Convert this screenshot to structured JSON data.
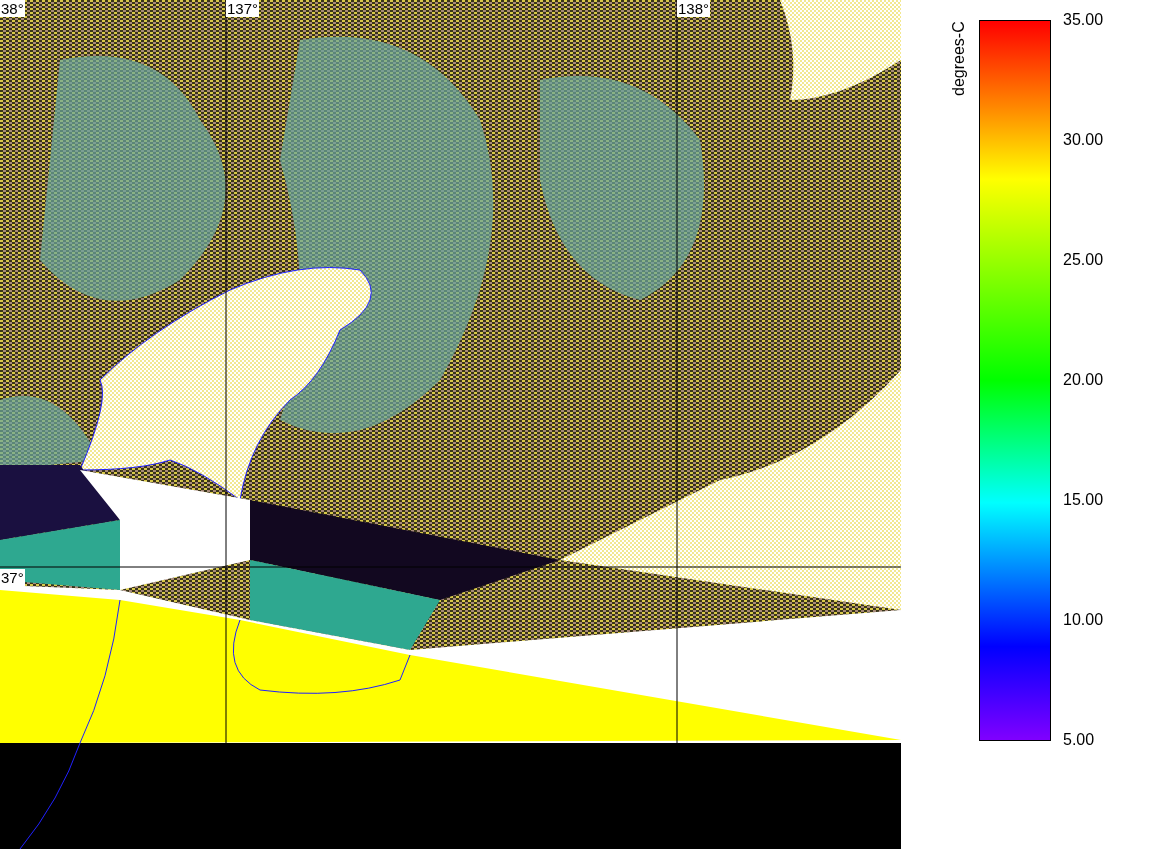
{
  "map": {
    "lon_labels": [
      "38°",
      "137°",
      "138°"
    ],
    "lat_labels": [
      "37°"
    ]
  },
  "colorbar": {
    "title": "degrees-C",
    "ticks": [
      "35.00",
      "30.00",
      "25.00",
      "20.00",
      "15.00",
      "10.00",
      "5.00"
    ]
  }
}
